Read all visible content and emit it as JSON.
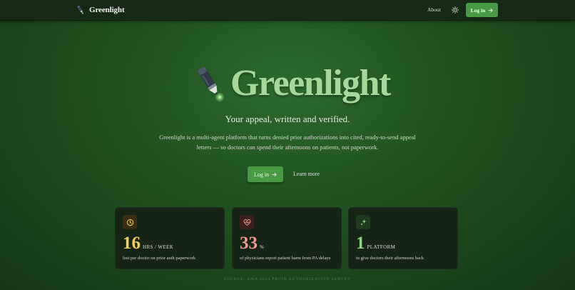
{
  "nav": {
    "brand": "Greenlight",
    "about_label": "About",
    "theme_icon": "sun-icon",
    "login_label": "Log in"
  },
  "hero": {
    "title": "Greenlight",
    "tagline": "Your appeal, written and verified.",
    "description": "Greenlight is a multi-agent platform that turns denied prior authorizations into cited, ready-to-send appeal letters — so doctors can spend their afternoons on patients, not paperwork.",
    "login_label": "Log in",
    "learn_more_label": "Learn more"
  },
  "stats": [
    {
      "icon": "clock-icon",
      "value": "16",
      "unit": "HRS / WEEK",
      "description": "lost per doctor on prior auth paperwork",
      "color": "#f2cf5b",
      "icon_bg": "#3a2f14"
    },
    {
      "icon": "heart-pulse-icon",
      "value": "33",
      "unit": "%",
      "description": "of physicians report patient harm from PA delays",
      "color": "#ef9a92",
      "icon_bg": "#3c1f1c"
    },
    {
      "icon": "sparkles-icon",
      "value": "1",
      "unit": "PLATFORM",
      "description": "to give doctors their afternoons back",
      "color": "#8fd386",
      "icon_bg": "#1f3a1e"
    }
  ],
  "source": "SOURCE: AMA 2024 PRIOR AUTHORIZATION SURVEY",
  "colors": {
    "accent": "#4a9a45",
    "title": "#a6d89a",
    "navbar": "#152915"
  }
}
